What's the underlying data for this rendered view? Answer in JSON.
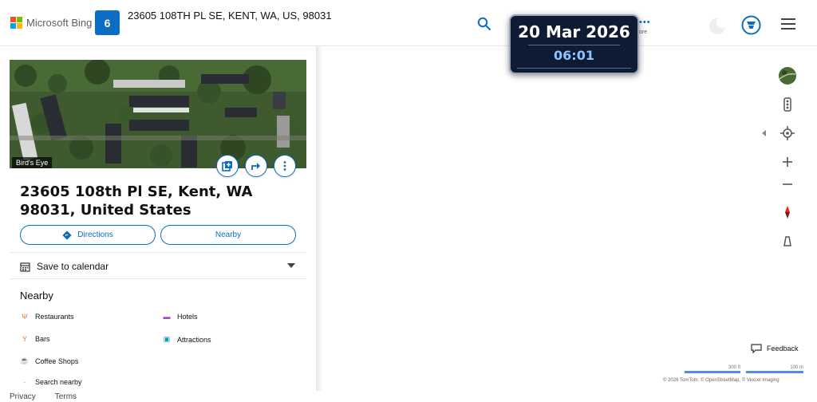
{
  "header": {
    "logo_text": "Microsoft Bing",
    "logo_colors": [
      "#f25022",
      "#7fba00",
      "#00a4ef",
      "#ffb900"
    ],
    "route_number": "6",
    "search_query": "23605 108TH PL SE, KENT, WA, US, 98031",
    "more_label": "ore",
    "accent_color": "#0c6dc4"
  },
  "overlay": {
    "date": "20 Mar 2026",
    "time": "06:01"
  },
  "panel": {
    "photo_label": "Bird's Eye",
    "address": "23605 108th Pl SE, Kent, WA 98031, United States",
    "directions_label": "Directions",
    "nearby_button_label": "Nearby",
    "save_calendar_label": "Save to calendar",
    "nearby_title": "Nearby",
    "categories": [
      {
        "label": "Restaurants",
        "icon": "fork-knife-icon",
        "color": "#d9773a"
      },
      {
        "label": "Hotels",
        "icon": "bed-icon",
        "color": "#a24fc5"
      },
      {
        "label": "Bars",
        "icon": "cocktail-icon",
        "color": "#d9773a"
      },
      {
        "label": "Attractions",
        "icon": "ticket-icon",
        "color": "#1497b5"
      },
      {
        "label": "Coffee Shops",
        "icon": "coffee-icon",
        "color": "#d9773a"
      },
      {
        "label": "Search nearby",
        "icon": "search-icon",
        "color": "#777777"
      }
    ]
  },
  "map": {
    "feedback_label": "Feedback",
    "scale_left": "300 ft",
    "scale_right": "100 m",
    "copyright": "© 2026 TomTom, © OpenStreetMap, © Vexcel Imaging"
  },
  "footer": {
    "privacy": "Privacy",
    "terms": "Terms"
  }
}
